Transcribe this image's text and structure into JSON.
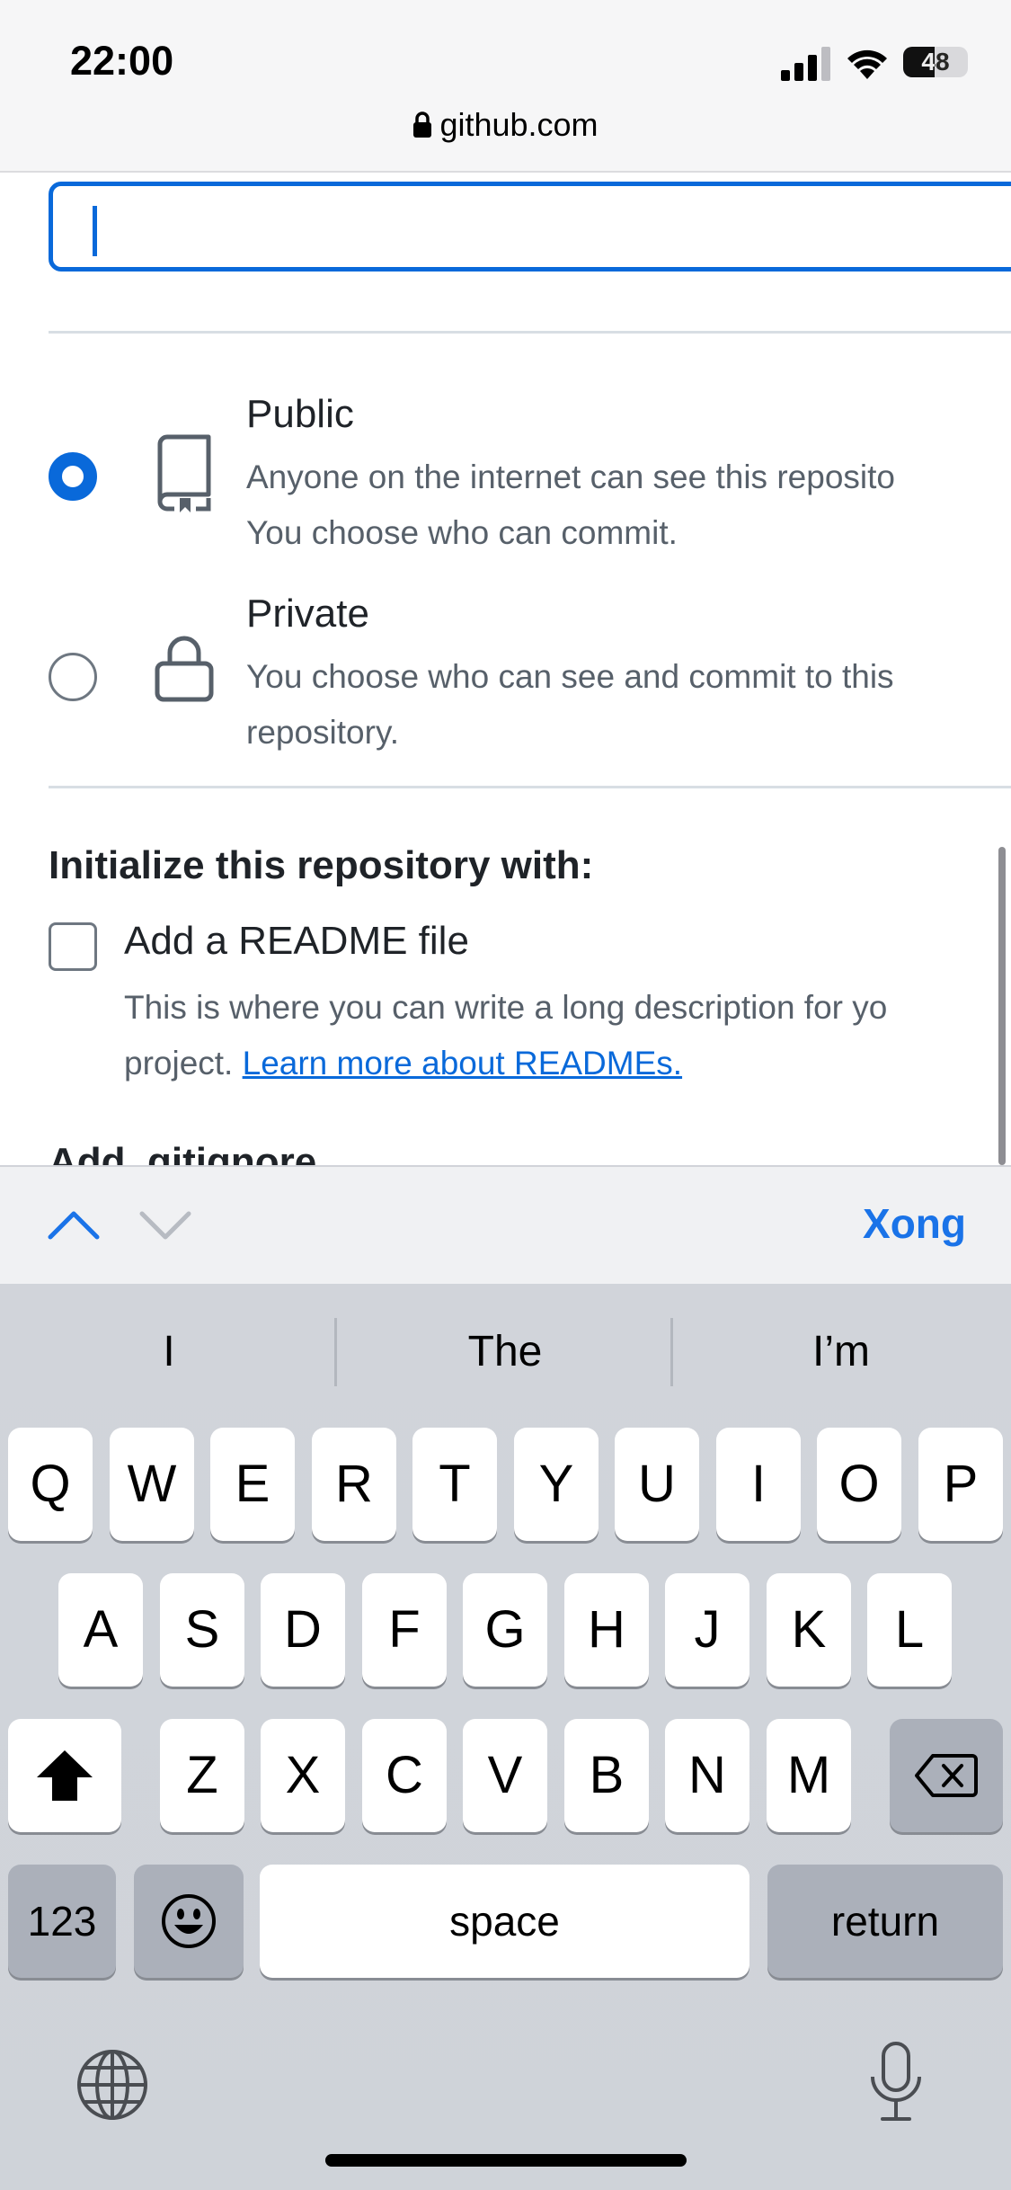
{
  "status_bar": {
    "time": "22:00",
    "battery_percent": "48",
    "battery_level": 0.48,
    "signal_icon": "cellular-signal-icon",
    "wifi_icon": "wifi-icon"
  },
  "url_bar": {
    "domain": "github.com",
    "lock_icon": "lock-icon"
  },
  "form": {
    "repo_name_value": "",
    "visibility_options": [
      {
        "title": "Public",
        "description_lines": [
          "Anyone on the internet can see this reposito",
          "You choose who can commit."
        ],
        "icon": "repo-book-icon",
        "selected": true
      },
      {
        "title": "Private",
        "description_lines": [
          "You choose who can see and commit to this",
          "repository."
        ],
        "icon": "lock-icon",
        "selected": false
      }
    ],
    "initialize_title": "Initialize this repository with:",
    "readme": {
      "label": "Add a README file",
      "checked": false,
      "description_line1": "This is where you can write a long description for yo",
      "description_line2_prefix": "project. ",
      "link_text": "Learn more about READMEs."
    },
    "next_heading_cut": "Add .gitignore"
  },
  "accessory_bar": {
    "prev_icon": "chevron-up-icon",
    "next_icon": "chevron-down-icon",
    "done_label": "Xong"
  },
  "keyboard": {
    "suggestions": [
      "I",
      "The",
      "I’m"
    ],
    "row1": [
      "Q",
      "W",
      "E",
      "R",
      "T",
      "Y",
      "U",
      "I",
      "O",
      "P"
    ],
    "row2": [
      "A",
      "S",
      "D",
      "F",
      "G",
      "H",
      "J",
      "K",
      "L"
    ],
    "row3": [
      "Z",
      "X",
      "C",
      "V",
      "B",
      "N",
      "M"
    ],
    "numbers_label": "123",
    "space_label": "space",
    "return_label": "return",
    "shift_icon": "shift-icon",
    "backspace_icon": "backspace-icon",
    "emoji_icon": "emoji-icon",
    "globe_icon": "globe-icon",
    "mic_icon": "microphone-icon"
  },
  "colors": {
    "accent": "#0969da",
    "done": "#1a73e8"
  }
}
